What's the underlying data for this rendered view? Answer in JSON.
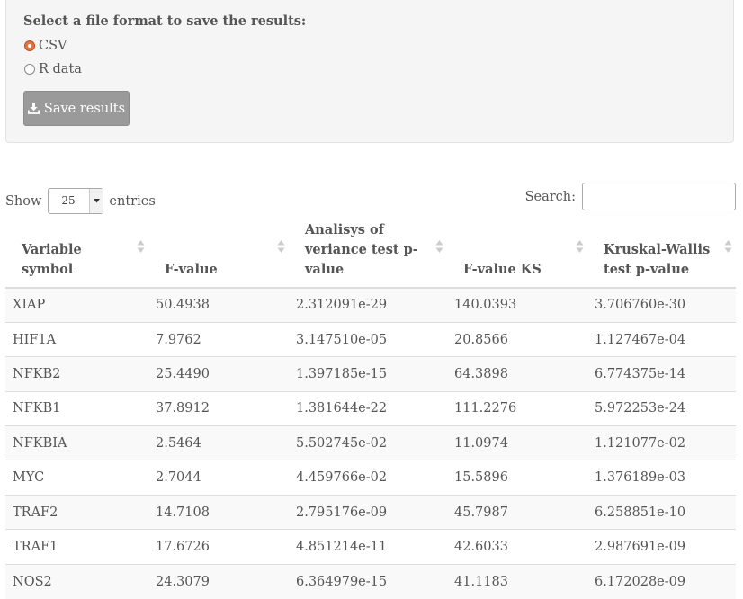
{
  "save_panel": {
    "title": "Select a file format to save the results:",
    "options": [
      {
        "label": "CSV",
        "checked": true
      },
      {
        "label": "R data",
        "checked": false
      }
    ],
    "save_button_label": "Save results",
    "save_button_icon": "download-icon"
  },
  "table_controls": {
    "show_label": "Show",
    "page_length": "25",
    "entries_label": "entries",
    "search_label": "Search:",
    "search_value": ""
  },
  "table": {
    "columns": [
      "Variable symbol",
      "F-value",
      "Analisys of veriance test p-value",
      "F-value KS",
      "Kruskal-Wallis test p-value"
    ],
    "rows": [
      [
        "XIAP",
        "50.4938",
        "2.312091e-29",
        "140.0393",
        "3.706760e-30"
      ],
      [
        "HIF1A",
        "7.9762",
        "3.147510e-05",
        "20.8566",
        "1.127467e-04"
      ],
      [
        "NFKB2",
        "25.4490",
        "1.397185e-15",
        "64.3898",
        "6.774375e-14"
      ],
      [
        "NFKB1",
        "37.8912",
        "1.381644e-22",
        "111.2276",
        "5.972253e-24"
      ],
      [
        "NFKBIA",
        "2.5464",
        "5.502745e-02",
        "11.0974",
        "1.121077e-02"
      ],
      [
        "MYC",
        "2.7044",
        "4.459766e-02",
        "15.5896",
        "1.376189e-03"
      ],
      [
        "TRAF2",
        "14.7108",
        "2.795176e-09",
        "45.7987",
        "6.258851e-10"
      ],
      [
        "TRAF1",
        "17.6726",
        "4.851214e-11",
        "42.6033",
        "2.987691e-09"
      ],
      [
        "NOS2",
        "24.3079",
        "6.364979e-15",
        "41.1183",
        "6.172028e-09"
      ]
    ]
  },
  "colors": {
    "radio_checked": "#e0773f",
    "button_bg": "#9a9a9a",
    "row_stripe": "#f9f9f9"
  }
}
